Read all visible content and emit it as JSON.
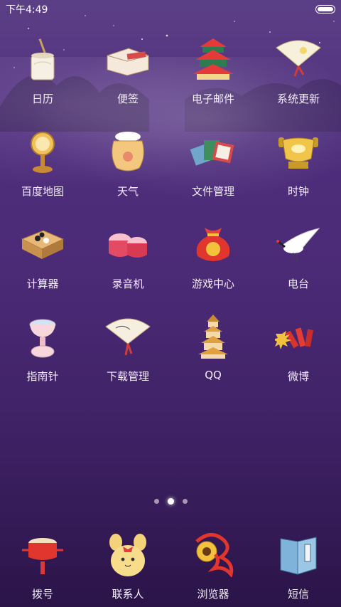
{
  "status_bar": {
    "time": "下午4:49"
  },
  "apps": [
    {
      "label": "日历",
      "icon": "brush-pot-icon"
    },
    {
      "label": "便签",
      "icon": "scroll-book-icon"
    },
    {
      "label": "电子邮件",
      "icon": "temple-icon"
    },
    {
      "label": "系统更新",
      "icon": "folding-fan-icon"
    },
    {
      "label": "百度地图",
      "icon": "mirror-stand-icon"
    },
    {
      "label": "天气",
      "icon": "wine-jar-icon"
    },
    {
      "label": "文件管理",
      "icon": "books-icon"
    },
    {
      "label": "时钟",
      "icon": "golden-cauldron-icon"
    },
    {
      "label": "计算器",
      "icon": "go-board-icon"
    },
    {
      "label": "录音机",
      "icon": "drums-icon"
    },
    {
      "label": "游戏中心",
      "icon": "lucky-bag-icon"
    },
    {
      "label": "电台",
      "icon": "crane-icon"
    },
    {
      "label": "指南针",
      "icon": "tea-cup-icon"
    },
    {
      "label": "下载管理",
      "icon": "painted-fan-icon"
    },
    {
      "label": "QQ",
      "icon": "pagoda-icon"
    },
    {
      "label": "微博",
      "icon": "firecrackers-icon"
    }
  ],
  "page_indicator": {
    "pages": 3,
    "active": 2
  },
  "dock": [
    {
      "label": "拨号",
      "icon": "rattle-drum-icon"
    },
    {
      "label": "联系人",
      "icon": "rabbit-icon"
    },
    {
      "label": "浏览器",
      "icon": "silk-ribbon-icon"
    },
    {
      "label": "短信",
      "icon": "open-book-icon"
    }
  ]
}
